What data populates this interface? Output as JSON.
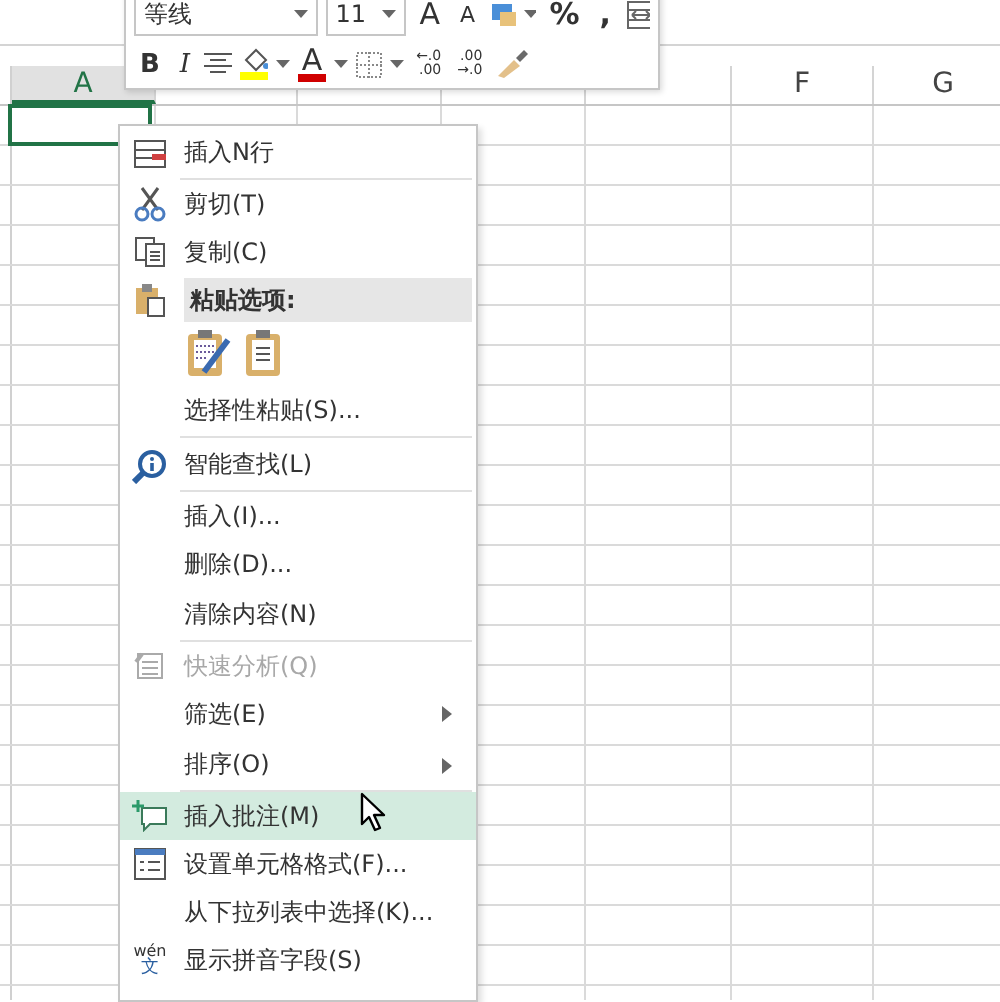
{
  "columns": [
    {
      "label": "A",
      "selected": true
    },
    {
      "selected": false
    },
    {
      "selected": false
    },
    {
      "selected": false
    },
    {
      "selected": false
    },
    {
      "label": "F",
      "selected": false
    },
    {
      "label": "G",
      "selected": false
    }
  ],
  "mini_toolbar": {
    "font_name": "等线",
    "font_size": "11",
    "grow_font": "A",
    "shrink_font": "A",
    "percent": "%",
    "comma": ",",
    "bold": "B",
    "italic": "I",
    "font_color_letter": "A",
    "increase_decimal": [
      "←.0",
      ".00"
    ],
    "decrease_decimal": [
      ".00",
      "→.0"
    ]
  },
  "context_menu": [
    {
      "kind": "item",
      "label": "插入N行",
      "disabled": false,
      "selected": false,
      "has_submenu": false,
      "separator_after": true
    },
    {
      "kind": "item",
      "label": "剪切(T)",
      "disabled": false,
      "selected": false,
      "has_submenu": false,
      "separator_after": false
    },
    {
      "kind": "item",
      "label": "复制(C)",
      "disabled": false,
      "selected": false,
      "has_submenu": false,
      "separator_after": false
    },
    {
      "kind": "header",
      "label": "粘贴选项:"
    },
    {
      "kind": "paste-options"
    },
    {
      "kind": "item",
      "label": "选择性粘贴(S)...",
      "disabled": false,
      "selected": false,
      "has_submenu": false,
      "separator_after": true
    },
    {
      "kind": "item",
      "label": "智能查找(L)",
      "disabled": false,
      "selected": false,
      "has_submenu": false,
      "separator_after": true
    },
    {
      "kind": "item",
      "label": "插入(I)...",
      "disabled": false,
      "selected": false,
      "has_submenu": false,
      "separator_after": false
    },
    {
      "kind": "item",
      "label": "删除(D)...",
      "disabled": false,
      "selected": false,
      "has_submenu": false,
      "separator_after": false
    },
    {
      "kind": "item",
      "label": "清除内容(N)",
      "disabled": false,
      "selected": false,
      "has_submenu": false,
      "separator_after": true
    },
    {
      "kind": "item",
      "label": "快速分析(Q)",
      "disabled": true,
      "selected": false,
      "has_submenu": false,
      "separator_after": false
    },
    {
      "kind": "item",
      "label": "筛选(E)",
      "disabled": false,
      "selected": false,
      "has_submenu": true,
      "separator_after": false
    },
    {
      "kind": "item",
      "label": "排序(O)",
      "disabled": false,
      "selected": false,
      "has_submenu": true,
      "separator_after": true
    },
    {
      "kind": "item",
      "label": "插入批注(M)",
      "disabled": false,
      "selected": true,
      "has_submenu": false,
      "separator_after": false
    },
    {
      "kind": "item",
      "label": "设置单元格格式(F)...",
      "disabled": false,
      "selected": false,
      "has_submenu": false,
      "separator_after": false
    },
    {
      "kind": "item",
      "label": "从下拉列表中选择(K)...",
      "disabled": false,
      "selected": false,
      "has_submenu": false,
      "separator_after": false
    },
    {
      "kind": "item",
      "icon_text": [
        "wén",
        "文"
      ],
      "label": "显示拼音字段(S)",
      "disabled": false,
      "selected": false,
      "has_submenu": false,
      "separator_after": false
    }
  ]
}
